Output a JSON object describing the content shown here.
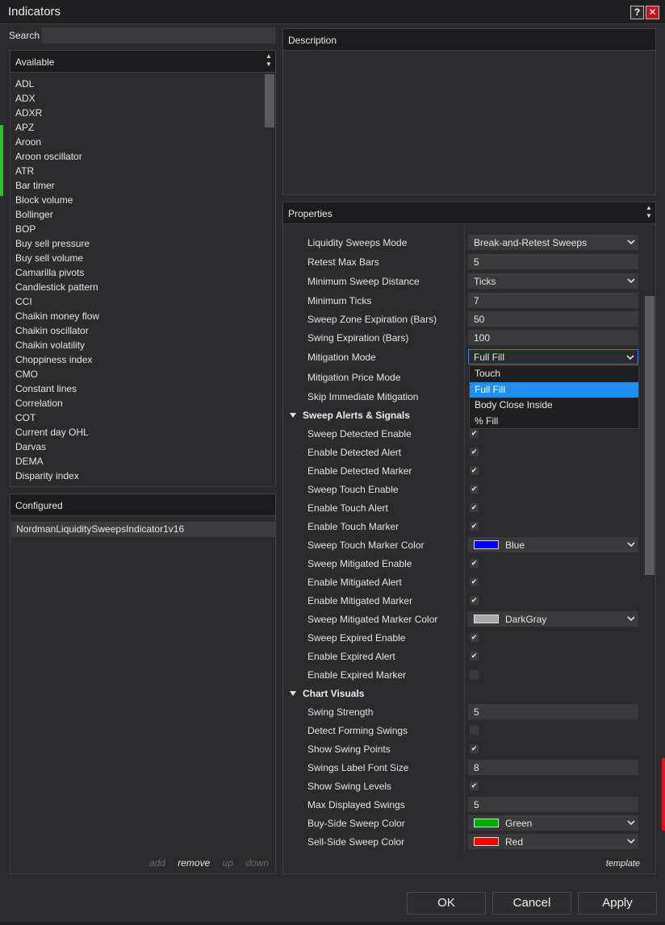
{
  "window": {
    "title": "Indicators",
    "help_label": "?",
    "close_label": "✕"
  },
  "search": {
    "label": "Search",
    "value": ""
  },
  "available": {
    "header": "Available",
    "items": [
      "ADL",
      "ADX",
      "ADXR",
      "APZ",
      "Aroon",
      "Aroon oscillator",
      "ATR",
      "Bar timer",
      "Block volume",
      "Bollinger",
      "BOP",
      "Buy sell pressure",
      "Buy sell volume",
      "Camarilla pivots",
      "Candlestick pattern",
      "CCI",
      "Chaikin money flow",
      "Chaikin oscillator",
      "Chaikin volatility",
      "Choppiness index",
      "CMO",
      "Constant lines",
      "Correlation",
      "COT",
      "Current day OHL",
      "Darvas",
      "DEMA",
      "Disparity index"
    ]
  },
  "configured": {
    "header": "Configured",
    "items": [
      "NordmanLiquiditySweepsIndicator1v16"
    ],
    "actions": {
      "add": "add",
      "remove": "remove",
      "up": "up",
      "down": "down"
    }
  },
  "description": {
    "header": "Description"
  },
  "properties": {
    "header": "Properties",
    "template_label": "template",
    "rows": {
      "r0": {
        "label": "Liquidity Sweeps Mode",
        "value": "Break-and-Retest Sweeps"
      },
      "r1": {
        "label": "Retest Max Bars",
        "value": "5"
      },
      "r2": {
        "label": "Minimum Sweep Distance",
        "value": "Ticks"
      },
      "r3": {
        "label": "Minimum Ticks",
        "value": "7"
      },
      "r4": {
        "label": "Sweep Zone Expiration (Bars)",
        "value": "50"
      },
      "r5": {
        "label": "Swing Expiration (Bars)",
        "value": "100"
      },
      "r6": {
        "label": "Mitigation Mode",
        "value": "Full Fill"
      },
      "r7": {
        "label": "Mitigation Price Mode"
      },
      "r8": {
        "label": "Skip Immediate Mitigation"
      },
      "s1": {
        "label": "Sweep Alerts & Signals"
      },
      "r9": {
        "label": "Sweep Detected Enable",
        "checked": true
      },
      "r10": {
        "label": "Enable Detected Alert",
        "checked": true
      },
      "r11": {
        "label": "Enable Detected Marker",
        "checked": true
      },
      "r12": {
        "label": "Sweep Touch Enable",
        "checked": true
      },
      "r13": {
        "label": "Enable Touch Alert",
        "checked": true
      },
      "r14": {
        "label": "Enable Touch Marker",
        "checked": true
      },
      "r15": {
        "label": "Sweep Touch Marker Color",
        "value": "Blue",
        "color": "#0000ff"
      },
      "r16": {
        "label": "Sweep Mitigated Enable",
        "checked": true
      },
      "r17": {
        "label": "Enable Mitigated Alert",
        "checked": true
      },
      "r18": {
        "label": "Enable Mitigated Marker",
        "checked": true
      },
      "r19": {
        "label": "Sweep Mitigated Marker Color",
        "value": "DarkGray",
        "color": "#a9a9a9"
      },
      "r20": {
        "label": "Sweep Expired Enable",
        "checked": true
      },
      "r21": {
        "label": "Enable Expired Alert",
        "checked": true
      },
      "r22": {
        "label": "Enable Expired Marker",
        "checked": false
      },
      "s2": {
        "label": "Chart Visuals"
      },
      "r23": {
        "label": "Swing Strength",
        "value": "5"
      },
      "r24": {
        "label": "Detect Forming Swings",
        "checked": false
      },
      "r25": {
        "label": "Show Swing Points",
        "checked": true
      },
      "r26": {
        "label": "Swings Label Font Size",
        "value": "8"
      },
      "r27": {
        "label": "Show Swing Levels",
        "checked": true
      },
      "r28": {
        "label": "Max Displayed Swings",
        "value": "5"
      },
      "r29": {
        "label": "Buy-Side Sweep Color",
        "value": "Green",
        "color": "#00aa00"
      },
      "r30": {
        "label": "Sell-Side Sweep Color",
        "value": "Red",
        "color": "#ff0000"
      }
    },
    "mitigation_dropdown": {
      "options": [
        "Touch",
        "Full Fill",
        "Body Close Inside",
        "% Fill"
      ],
      "selected": "Full Fill"
    }
  },
  "buttons": {
    "ok": "OK",
    "cancel": "Cancel",
    "apply": "Apply"
  },
  "colors": {
    "accent": "#1e8ff2",
    "close": "#c4141c",
    "indicator_green": "#27c12a",
    "indicator_red": "#d11a1a"
  }
}
